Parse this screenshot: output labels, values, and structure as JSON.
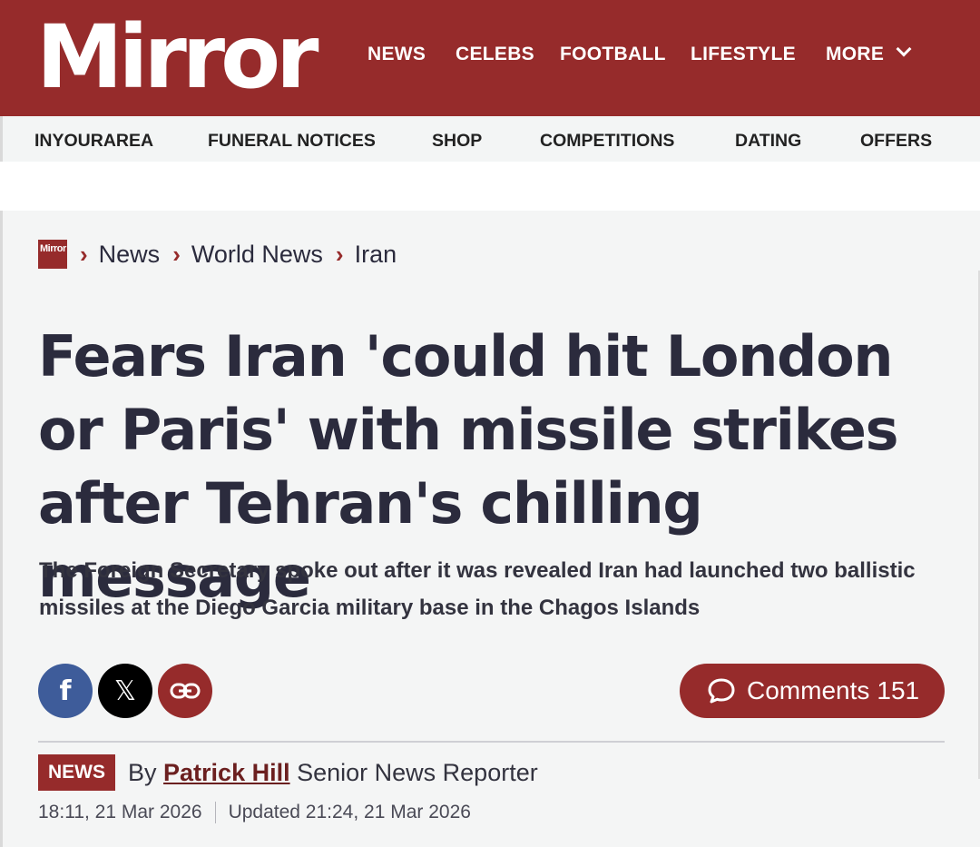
{
  "brand": {
    "logo_text": "Mirror",
    "mini_logo_text": "Mirror",
    "accent": "#962b2b"
  },
  "main_nav": [
    {
      "label": "NEWS"
    },
    {
      "label": "CELEBS"
    },
    {
      "label": "FOOTBALL"
    },
    {
      "label": "LIFESTYLE"
    },
    {
      "label": "MORE",
      "icon": "chevron-down-icon"
    }
  ],
  "sub_nav": [
    {
      "label": "INYOURAREA"
    },
    {
      "label": "FUNERAL NOTICES"
    },
    {
      "label": "SHOP"
    },
    {
      "label": "COMPETITIONS"
    },
    {
      "label": "DATING"
    },
    {
      "label": "OFFERS"
    }
  ],
  "breadcrumb": [
    "News",
    "World News",
    "Iran"
  ],
  "article": {
    "headline": "Fears Iran 'could hit London or Paris' with missile strikes after Tehran's chilling message",
    "standfirst": "The Foreign Secretary spoke out after it was revealed Iran had launched two ballistic missiles at the Diego Garcia military base in the Chagos Islands",
    "tag": "NEWS",
    "by_prefix": "By",
    "author": "Patrick Hill",
    "author_role": "Senior News Reporter",
    "published": "18:11, 21 Mar 2026",
    "updated": "Updated 21:24, 21 Mar 2026"
  },
  "share": {
    "facebook_glyph": "f",
    "x_glyph": "𝕏",
    "icons": [
      "facebook-icon",
      "x-icon",
      "link-icon"
    ],
    "colors": {
      "facebook": "#3e5c9a",
      "x": "#000000",
      "link": "#962b2b"
    }
  },
  "comments": {
    "label": "Comments",
    "count": "151"
  }
}
